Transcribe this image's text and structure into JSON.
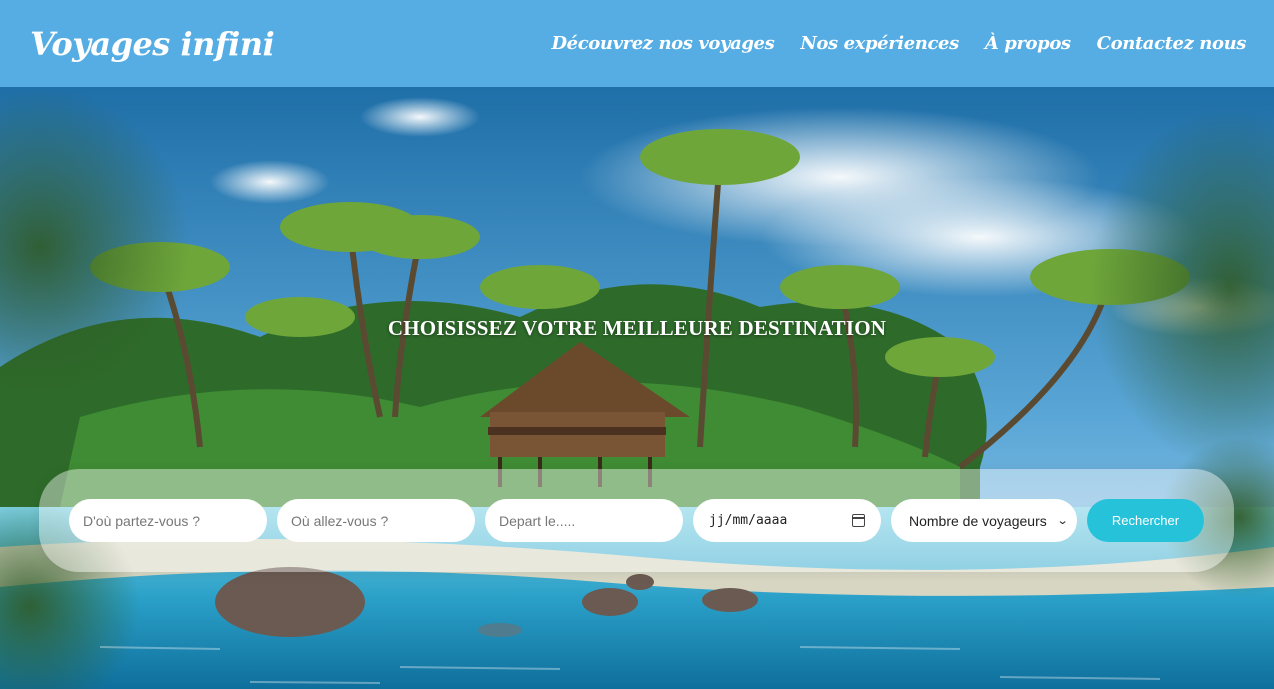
{
  "header": {
    "logo": "Voyages infini",
    "nav": [
      "Découvrez nos voyages",
      "Nos expériences",
      "À propos",
      "Contactez nous"
    ]
  },
  "hero": {
    "title": "CHOISISSEZ VOTRE MEILLEURE DESTINATION"
  },
  "search": {
    "from_placeholder": "D'où partez-vous ?",
    "to_placeholder": "Où allez-vous ?",
    "depart_placeholder": "Depart le.....",
    "date_value": "jj/mm/aaaa",
    "travelers_selected": "Nombre de voyageurs",
    "button_label": "Rechercher"
  },
  "colors": {
    "header_bg": "#55ade3",
    "button_bg": "#26c2d9"
  }
}
